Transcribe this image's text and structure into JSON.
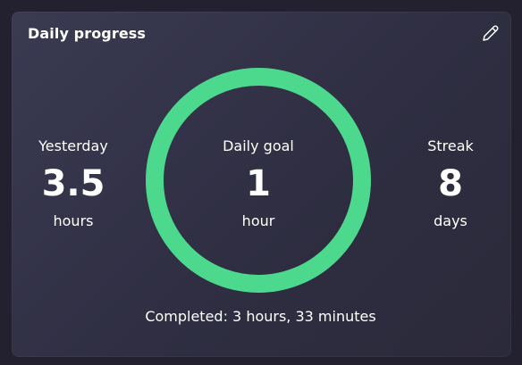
{
  "card": {
    "title": "Daily progress",
    "edit_icon": "pencil-icon"
  },
  "yesterday": {
    "label": "Yesterday",
    "value": "3.5",
    "unit": "hours"
  },
  "daily_goal": {
    "label": "Daily goal",
    "value": "1",
    "unit": "hour",
    "progress_fraction": 1.0,
    "ring_color": "#4cd98e"
  },
  "streak": {
    "label": "Streak",
    "value": "8",
    "unit": "days"
  },
  "completed_text": "Completed: 3 hours, 33 minutes"
}
